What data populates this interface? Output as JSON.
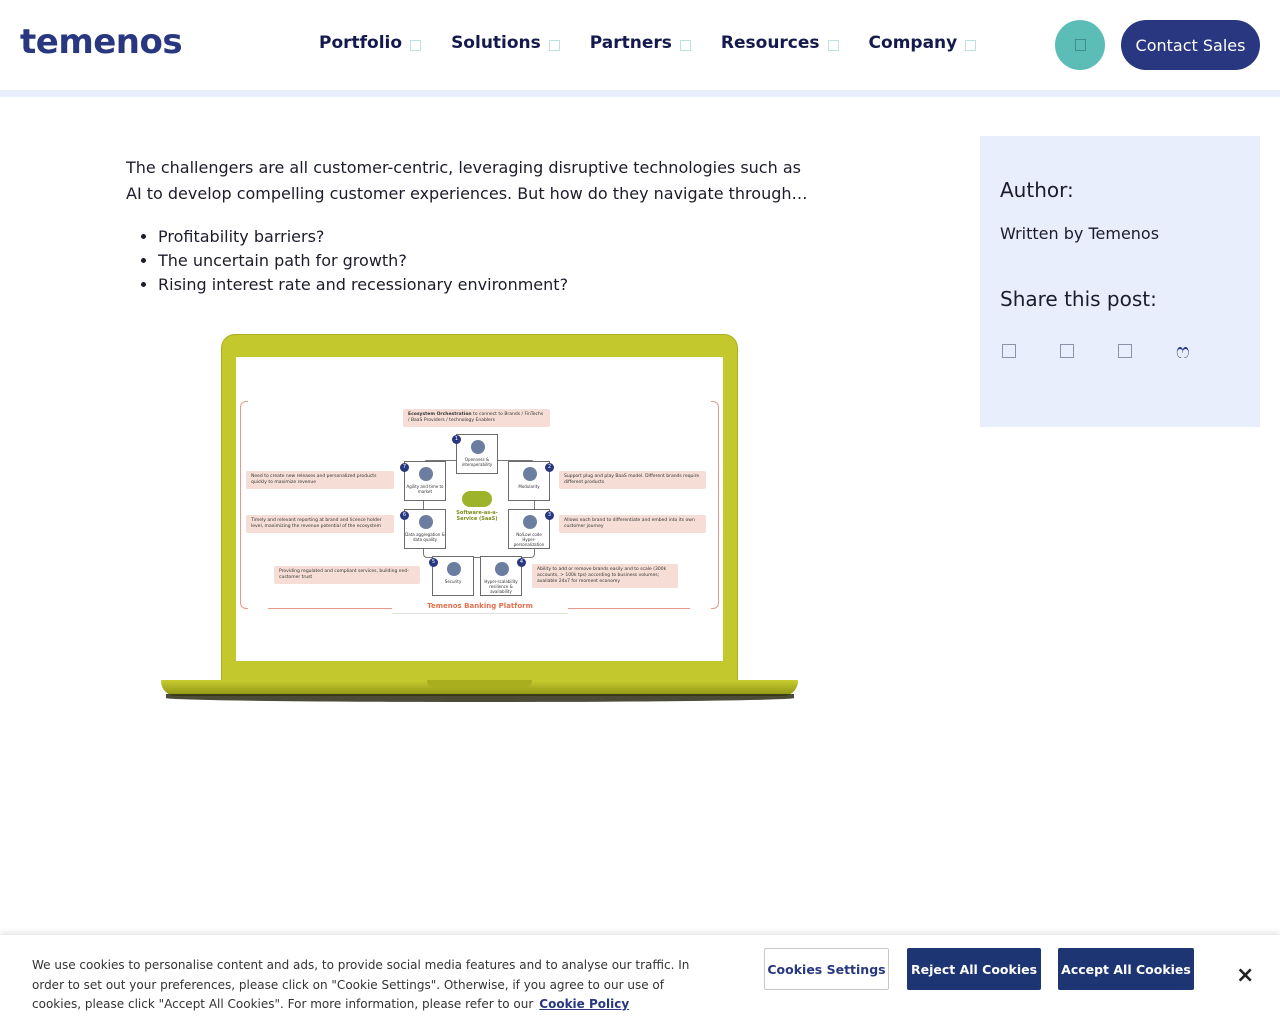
{
  "header": {
    "logo": "temenos",
    "nav": [
      {
        "label": "Portfolio"
      },
      {
        "label": "Solutions"
      },
      {
        "label": "Partners"
      },
      {
        "label": "Resources"
      },
      {
        "label": "Company"
      }
    ],
    "contact_label": "Contact Sales"
  },
  "article": {
    "intro": "The challengers are all customer-centric, leveraging disruptive technologies such as AI to develop compelling customer experiences. But how do they navigate through…",
    "bullets": [
      "Profitability barriers?",
      "The uncertain path for growth?",
      "Rising interest rate and recessionary environment?"
    ]
  },
  "diagram": {
    "top_note_bold": "Ecosystem Orchestration",
    "top_note": " to connect to Brands / FinTechs / BaaS Providers / technology Enablers",
    "nodes": [
      {
        "num": "1",
        "label": "Openness & interoperability"
      },
      {
        "num": "2",
        "label": "Modularity"
      },
      {
        "num": "3",
        "label": "No/Low code Hyper-personalization"
      },
      {
        "num": "4",
        "label": "Hyper-scalability resilience & availability"
      },
      {
        "num": "5",
        "label": "Security"
      },
      {
        "num": "6",
        "label": "Data aggregation & data quality"
      },
      {
        "num": "7",
        "label": "Agility and time to market"
      }
    ],
    "center": "Software-as-a-Service (SaaS)",
    "notes": [
      "Need to create new releases and personalized products quickly to maximize revenue",
      "Timely and relevant reporting at brand and licence holder level, maximizing the revenue potential of the ecosystem",
      "Providing regulated and compliant services, building end-customer trust",
      "Support plug and play BaaS model. Different brands require different products",
      "Allows each brand to differentiate and embed into its own customer journey",
      "Ability to add or remove brands easily and to scale (300k accounts, > 100k tps) according to business volumes; available 24x7 for moment economy"
    ],
    "platform": "Temenos Banking Platform"
  },
  "sidebar": {
    "author_title": "Author:",
    "author": "Written by Temenos",
    "share_title": "Share this post:",
    "share_icons": [
      "linkedin-icon",
      "twitter-icon",
      "facebook-icon",
      "email-icon"
    ],
    "last_icon_glyph": "ෆ"
  },
  "cookie": {
    "text": "We use cookies to personalise content and ads, to provide social media features and to analyse our traffic. In order to set out your preferences, please click on \"Cookie Settings\". Otherwise, if you agree to our use of cookies, please click \"Accept All Cookies\". For more information, please refer to our",
    "link": "Cookie Policy",
    "settings_label": "Cookies Settings",
    "reject_label": "Reject All Cookies",
    "accept_label": "Accept All Cookies",
    "close_glyph": "×"
  },
  "colors": {
    "brand": "#283780",
    "teal": "#5bbdb6",
    "laptop": "#c3c82c",
    "sidebar_bg": "#e8eefc"
  }
}
